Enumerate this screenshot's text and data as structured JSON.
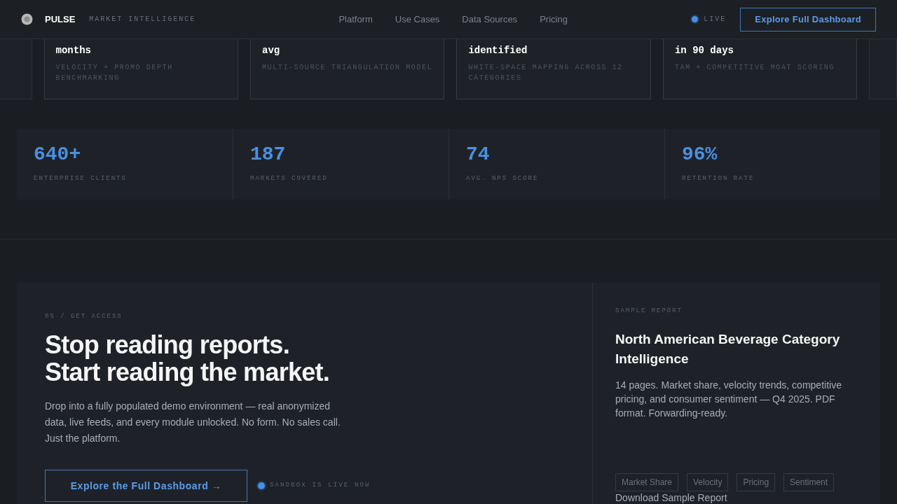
{
  "header": {
    "brand": "PULSE",
    "tagline": "MARKET INTELLIGENCE",
    "nav": [
      "Platform",
      "Use Cases",
      "Data Sources",
      "Pricing"
    ],
    "live_label": "LIVE",
    "cta": "Explore Full Dashboard"
  },
  "cases": [
    {
      "title": "months",
      "detail": "VELOCITY + PROMO DEPTH BENCHMARKING"
    },
    {
      "title": "avg",
      "detail": "MULTI-SOURCE TRIANGULATION MODEL"
    },
    {
      "title": "identified",
      "detail": "WHITE-SPACE MAPPING ACROSS 12 CATEGORIES"
    },
    {
      "title": "in 90 days",
      "detail": "TAM + COMPETITIVE MOAT SCORING"
    }
  ],
  "stats": [
    {
      "value": "640+",
      "label": "ENTERPRISE CLIENTS"
    },
    {
      "value": "187",
      "label": "MARKETS COVERED"
    },
    {
      "value": "74",
      "label": "AVG. NPS SCORE"
    },
    {
      "value": "96%",
      "label": "RETENTION RATE"
    }
  ],
  "access": {
    "eyebrow": "05 / GET ACCESS",
    "headline": [
      "Stop reading reports.",
      "Start reading the market."
    ],
    "body": "Drop into a fully populated demo environment — real anonymized data, live feeds, and every module unlocked. No form. No sales call. Just the platform.",
    "cta": "Explore the Full Dashboard →",
    "status": "SANDBOX IS LIVE NOW"
  },
  "report": {
    "eyebrow": "SAMPLE REPORT",
    "title": "North American Beverage Category Intelligence",
    "body": "14 pages. Market share, velocity trends, competitive pricing, and consumer sentiment — Q4 2025. PDF format. Forwarding-ready.",
    "tags": [
      "Market Share",
      "Velocity",
      "Pricing",
      "Sentiment"
    ],
    "link": "Download Sample Report"
  }
}
